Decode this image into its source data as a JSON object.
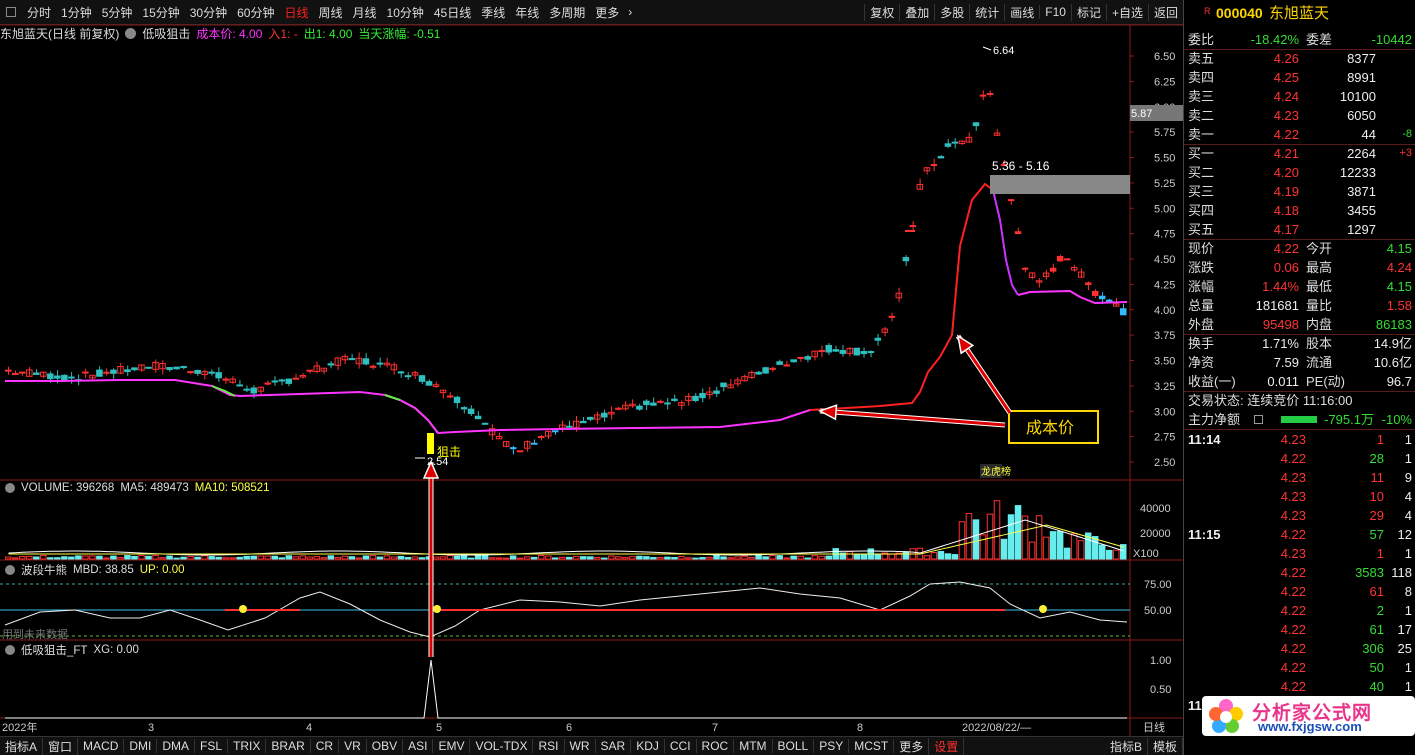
{
  "toolbar": {
    "periods": [
      "分时",
      "1分钟",
      "5分钟",
      "15分钟",
      "30分钟",
      "60分钟",
      "日线",
      "周线",
      "月线",
      "10分钟",
      "45日线",
      "季线",
      "年线",
      "多周期",
      "更多"
    ],
    "selected": "日线",
    "actions": [
      "复权",
      "叠加",
      "多股",
      "统计",
      "画线",
      "F10",
      "标记",
      "+自选",
      "返回"
    ]
  },
  "chart": {
    "title": "东旭蓝天(日线 前复权)",
    "indicator": "低吸狙击",
    "cost_label": "成本价: 4.00",
    "in_label": "入1: -",
    "out_label": "出1: 4.00",
    "today_label": "当天涨幅: -0.51",
    "y_ticks": [
      "6.50",
      "6.25",
      "6.00",
      "5.75",
      "5.50",
      "5.25",
      "5.00",
      "4.75",
      "4.50",
      "4.25",
      "4.00",
      "3.75",
      "3.50",
      "3.25",
      "3.00",
      "2.75",
      "2.50"
    ],
    "price_tag": "5.87",
    "high_label": "6.64",
    "low_label": "2.54",
    "zone_label": "5.36 - 5.16",
    "snipe_label": "狙击",
    "event_tag": "龙虎榜",
    "callout": "成本价"
  },
  "volume": {
    "title": "VOLUME: 396268",
    "ma5": "MA5: 489473",
    "ma10": "MA10: 508521",
    "ticks": [
      "40000",
      "20000"
    ],
    "unit": "X100"
  },
  "wave": {
    "title": "波段牛熊",
    "mbd": "MBD: 38.85",
    "up": "UP: 0.00",
    "ticks": [
      "75.00",
      "50.00"
    ],
    "note": "用到未来数据"
  },
  "signal": {
    "title": "低吸狙击_FT",
    "xg": "XG: 0.00",
    "ticks": [
      "1.00",
      "0.50"
    ]
  },
  "xaxis": {
    "labels": [
      "2022年",
      "3",
      "4",
      "5",
      "6",
      "7",
      "8",
      "2022/08/22/—"
    ],
    "mode": "日线"
  },
  "bottom_tabs": [
    "指标A",
    "窗口",
    "MACD",
    "DMI",
    "DMA",
    "FSL",
    "TRIX",
    "BRAR",
    "CR",
    "VR",
    "OBV",
    "ASI",
    "EMV",
    "VOL-TDX",
    "RSI",
    "WR",
    "SAR",
    "KDJ",
    "CCI",
    "ROC",
    "MTM",
    "BOLL",
    "PSY",
    "MCST",
    "更多",
    "设置"
  ],
  "bottom_right": [
    "指标B",
    "模板"
  ],
  "quote": {
    "code": "000040",
    "name": "东旭蓝天",
    "webi_label": "委比",
    "webi": "-18.42%",
    "wecha_label": "委差",
    "wecha": "-10442",
    "asks": [
      {
        "label": "卖五",
        "price": "4.26",
        "vol": "8377",
        "chg": ""
      },
      {
        "label": "卖四",
        "price": "4.25",
        "vol": "8991",
        "chg": ""
      },
      {
        "label": "卖三",
        "price": "4.24",
        "vol": "10100",
        "chg": ""
      },
      {
        "label": "卖二",
        "price": "4.23",
        "vol": "6050",
        "chg": ""
      },
      {
        "label": "卖一",
        "price": "4.22",
        "vol": "44",
        "chg": "-8"
      }
    ],
    "bids": [
      {
        "label": "买一",
        "price": "4.21",
        "vol": "2264",
        "chg": "+3"
      },
      {
        "label": "买二",
        "price": "4.20",
        "vol": "12233",
        "chg": ""
      },
      {
        "label": "买三",
        "price": "4.19",
        "vol": "3871",
        "chg": ""
      },
      {
        "label": "买四",
        "price": "4.18",
        "vol": "3455",
        "chg": ""
      },
      {
        "label": "买五",
        "price": "4.17",
        "vol": "1297",
        "chg": ""
      }
    ],
    "stats": [
      {
        "l1": "现价",
        "v1": "4.22",
        "c1": "#ff3333",
        "l2": "今开",
        "v2": "4.15",
        "c2": "#33dd33"
      },
      {
        "l1": "涨跌",
        "v1": "0.06",
        "c1": "#ff3333",
        "l2": "最高",
        "v2": "4.24",
        "c2": "#ff3333"
      },
      {
        "l1": "涨幅",
        "v1": "1.44%",
        "c1": "#ff3333",
        "l2": "最低",
        "v2": "4.15",
        "c2": "#33dd33"
      },
      {
        "l1": "总量",
        "v1": "181681",
        "c1": "#eeeeee",
        "l2": "量比",
        "v2": "1.58",
        "c2": "#ff3333"
      },
      {
        "l1": "外盘",
        "v1": "95498",
        "c1": "#ff3333",
        "l2": "内盘",
        "v2": "86183",
        "c2": "#33dd33"
      },
      {
        "l1": "换手",
        "v1": "1.71%",
        "c1": "#eeeeee",
        "l2": "股本",
        "v2": "14.9亿",
        "c2": "#eeeeee"
      },
      {
        "l1": "净资",
        "v1": "7.59",
        "c1": "#eeeeee",
        "l2": "流通",
        "v2": "10.6亿",
        "c2": "#eeeeee"
      },
      {
        "l1": "收益(一)",
        "v1": "0.011",
        "c1": "#eeeeee",
        "l2": "PE(动)",
        "v2": "96.7",
        "c2": "#eeeeee"
      }
    ],
    "trade_status": "交易状态: 连续竞价 11:16:00",
    "main_flow_label": "主力净额",
    "main_flow": "-795.1万",
    "main_pct": "-10%",
    "ticks": [
      {
        "t": "11:14",
        "p": "4.23",
        "v": "1",
        "n": "1",
        "vc": "#ff3333"
      },
      {
        "t": "",
        "p": "4.22",
        "v": "28",
        "n": "1",
        "vc": "#33dd33"
      },
      {
        "t": "",
        "p": "4.23",
        "v": "11",
        "n": "9",
        "vc": "#ff3333"
      },
      {
        "t": "",
        "p": "4.23",
        "v": "10",
        "n": "4",
        "vc": "#ff3333"
      },
      {
        "t": "",
        "p": "4.23",
        "v": "29",
        "n": "4",
        "vc": "#ff3333"
      },
      {
        "t": "11:15",
        "p": "4.22",
        "v": "57",
        "n": "12",
        "vc": "#33dd33"
      },
      {
        "t": "",
        "p": "4.23",
        "v": "1",
        "n": "1",
        "vc": "#ff3333"
      },
      {
        "t": "",
        "p": "4.22",
        "v": "3583",
        "n": "118",
        "vc": "#33dd33"
      },
      {
        "t": "",
        "p": "4.22",
        "v": "61",
        "n": "8",
        "vc": "#ff3333"
      },
      {
        "t": "",
        "p": "4.22",
        "v": "2",
        "n": "1",
        "vc": "#33dd33"
      },
      {
        "t": "",
        "p": "4.22",
        "v": "61",
        "n": "17",
        "vc": "#33dd33"
      },
      {
        "t": "",
        "p": "4.22",
        "v": "306",
        "n": "25",
        "vc": "#33dd33"
      },
      {
        "t": "",
        "p": "4.22",
        "v": "50",
        "n": "1",
        "vc": "#33dd33"
      },
      {
        "t": "",
        "p": "4.22",
        "v": "40",
        "n": "1",
        "vc": "#33dd33"
      },
      {
        "t": "11",
        "p": "",
        "v": "",
        "n": "",
        "vc": "#33dd33"
      }
    ]
  },
  "watermark": {
    "title": "分析家公式网",
    "url": "www.fxjgsw.com"
  }
}
